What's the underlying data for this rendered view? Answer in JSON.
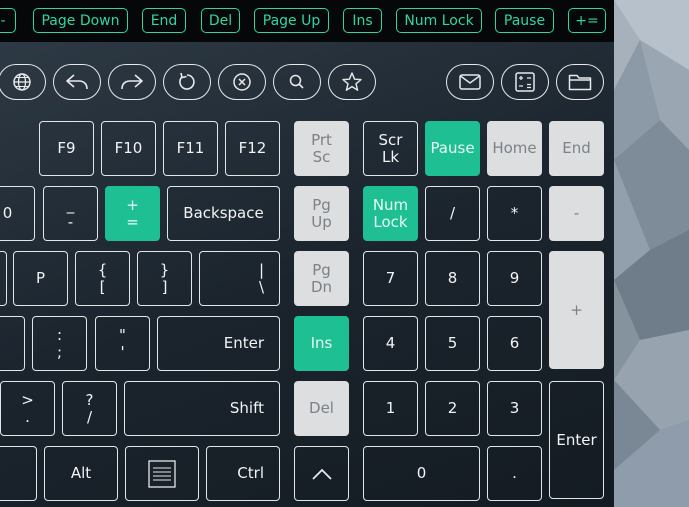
{
  "top_strip": {
    "chips": [
      "-",
      "Page Down",
      "End",
      "Del",
      "Page Up",
      "Ins",
      "Num Lock",
      "Pause",
      "+="
    ]
  },
  "toolbar": {
    "icons": [
      "globe-icon",
      "undo-icon",
      "redo-icon",
      "refresh-icon",
      "clear-icon",
      "search-icon",
      "star-icon",
      "mail-icon",
      "calculator-icon",
      "folder-icon"
    ]
  },
  "keys": {
    "f9": "F9",
    "f10": "F10",
    "f11": "F11",
    "f12": "F12",
    "prtsc": [
      "Prt",
      "Sc"
    ],
    "scrlk": [
      "Scr",
      "Lk"
    ],
    "pause": "Pause",
    "home": "Home",
    "end": "End",
    "zero": "0",
    "minus": [
      "_",
      "-"
    ],
    "equals": [
      "+",
      "="
    ],
    "backspace": "Backspace",
    "pgup": [
      "Pg",
      "Up"
    ],
    "numlock": [
      "Num",
      "Lock"
    ],
    "np_div": "/",
    "np_mul": "*",
    "np_minus": "-",
    "p": "P",
    "lbrace": [
      "{",
      "["
    ],
    "rbrace": [
      "}",
      "]"
    ],
    "pipe": [
      "|",
      "\\"
    ],
    "pgdn": [
      "Pg",
      "Dn"
    ],
    "np7": "7",
    "np8": "8",
    "np9": "9",
    "np_plus": "+",
    "colon": [
      ":",
      ";"
    ],
    "quote": [
      "\"",
      "'"
    ],
    "enter": "Enter",
    "ins": "Ins",
    "np4": "4",
    "np5": "5",
    "np6": "6",
    "gt": [
      ">",
      "."
    ],
    "question": [
      "?",
      "/"
    ],
    "shift": "Shift",
    "del": "Del",
    "np1": "1",
    "np2": "2",
    "np3": "3",
    "np_enter": "Enter",
    "alt": "Alt",
    "ctrl": "Ctrl",
    "np0": "0",
    "np_dot": "."
  },
  "colors": {
    "accent": "#1fbf94",
    "chip": "#2fd6a5",
    "light_key": "#dcdedf"
  }
}
